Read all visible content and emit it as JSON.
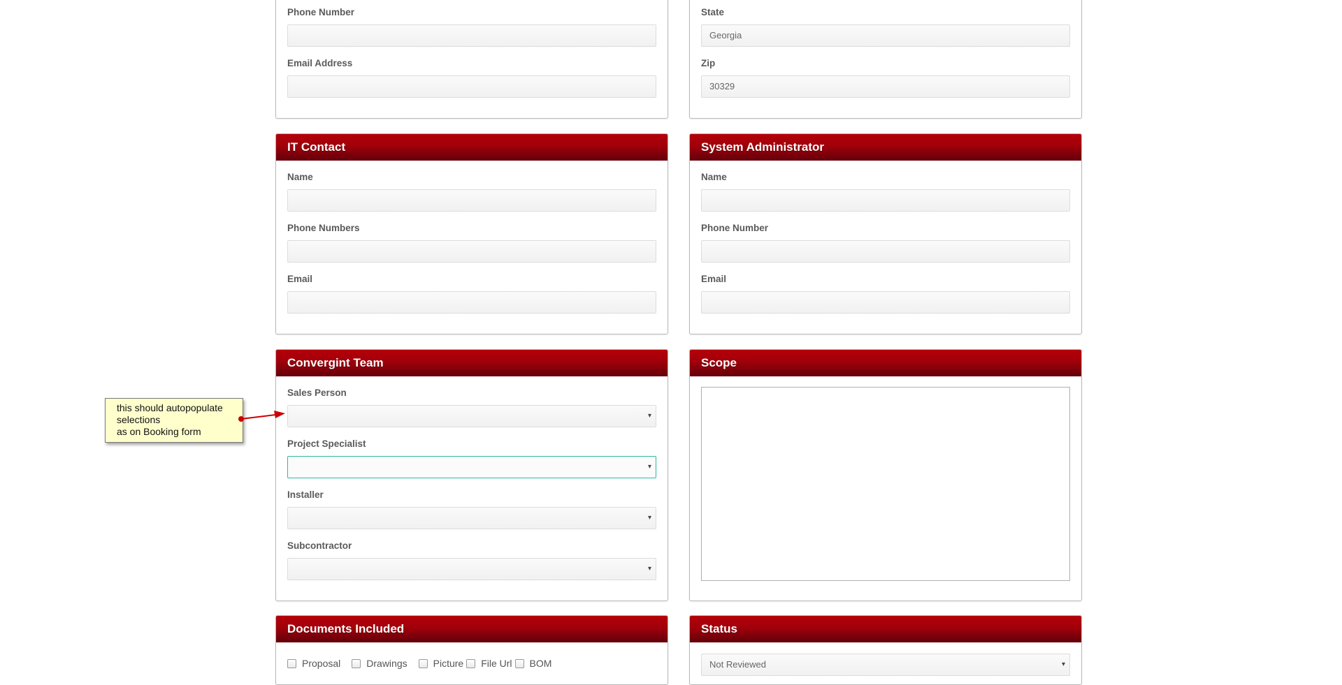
{
  "contact_panel": {
    "phone_label": "Phone Number",
    "phone_value": "",
    "email_label": "Email Address",
    "email_value": ""
  },
  "address_panel": {
    "state_label": "State",
    "state_value": "Georgia",
    "zip_label": "Zip",
    "zip_value": "30329"
  },
  "it_contact": {
    "title": "IT Contact",
    "name_label": "Name",
    "phones_label": "Phone Numbers",
    "email_label": "Email"
  },
  "sys_admin": {
    "title": "System Administrator",
    "name_label": "Name",
    "phone_label": "Phone Number",
    "email_label": "Email"
  },
  "team": {
    "title": "Convergint Team",
    "sales_label": "Sales Person",
    "specialist_label": "Project Specialist",
    "installer_label": "Installer",
    "sub_label": "Subcontractor",
    "sales_value": "",
    "specialist_value": "",
    "installer_value": "",
    "sub_value": ""
  },
  "scope": {
    "title": "Scope",
    "value": ""
  },
  "documents": {
    "title": "Documents Included",
    "items": [
      "Proposal",
      "Drawings",
      "Picture",
      "File Url",
      "BOM"
    ]
  },
  "status": {
    "title": "Status",
    "value": "Not Reviewed"
  },
  "annotation": {
    "line1": "this should autopopulate",
    "line2": "selections",
    "line3": "as on Booking form",
    "arrow_color": "#cc0000"
  },
  "icons": {
    "dropdown": "▾"
  }
}
